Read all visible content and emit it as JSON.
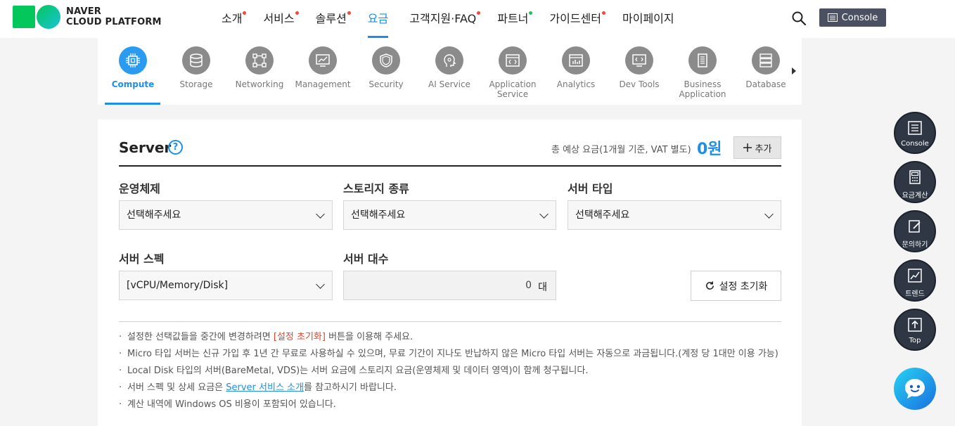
{
  "header": {
    "logo_line1": "NAVER",
    "logo_line2": "CLOUD PLATFORM",
    "nav": [
      {
        "label": "소개",
        "dot": "#f04a3a"
      },
      {
        "label": "서비스",
        "dot": "#f04a3a"
      },
      {
        "label": "솔루션",
        "dot": "#f04a3a"
      },
      {
        "label": "요금",
        "dot": "",
        "active": true
      },
      {
        "label": "고객지원·FAQ",
        "dot": "#f04a3a"
      },
      {
        "label": "파트너",
        "dot": "#2bbf5a"
      },
      {
        "label": "가이드센터",
        "dot": "#f04a3a"
      },
      {
        "label": "마이페이지",
        "dot": ""
      }
    ],
    "console_label": "Console"
  },
  "categories": [
    {
      "label": "Compute",
      "icon": "cpu-icon",
      "active": true
    },
    {
      "label": "Storage",
      "icon": "database-icon"
    },
    {
      "label": "Networking",
      "icon": "network-icon"
    },
    {
      "label": "Management",
      "icon": "monitor-chart-icon"
    },
    {
      "label": "Security",
      "icon": "shield-icon"
    },
    {
      "label": "AI Service",
      "icon": "ai-head-icon"
    },
    {
      "label": "Application Service",
      "icon": "app-window-icon"
    },
    {
      "label": "Analytics",
      "icon": "analytics-icon"
    },
    {
      "label": "Dev Tools",
      "icon": "code-monitor-icon"
    },
    {
      "label": "Business Application",
      "icon": "document-icon"
    },
    {
      "label": "Database",
      "icon": "server-stack-icon"
    }
  ],
  "main": {
    "title": "Server",
    "estimate_label": "총 예상 요금(1개월 기준, VAT 별도)",
    "estimate_value": "0원",
    "add_label": "추가",
    "fields": {
      "os_label": "운영체제",
      "os_value": "선택해주세요",
      "storage_label": "스토리지 종류",
      "storage_value": "선택해주세요",
      "type_label": "서버 타입",
      "type_value": "선택해주세요",
      "spec_label": "서버 스펙",
      "spec_value": "[vCPU/Memory/Disk]",
      "count_label": "서버 대수",
      "count_value": "0",
      "count_unit": "대"
    },
    "reset_label": "설정 초기화",
    "notes": {
      "n1_pre": "설정한 선택값들을 중간에 변경하려면 ",
      "n1_hl": "[설정 초기화]",
      "n1_post": " 버튼을 이용해 주세요.",
      "n2": "Micro 타입 서버는 신규 가입 후 1년 간 무료로 사용하실 수 있으며, 무료 기간이 지나도 반납하지 않은 Micro 타입 서버는 자동으로 과금됩니다.(계정 당 1대만 이용 가능)",
      "n3": "Local Disk 타입의 서버(BareMetal, VDS)는 서버 요금에 스토리지 요금(운영체제 및 데이터 영역)이 함께 청구됩니다.",
      "n4_pre": "서버 스펙 및 상세 요금은 ",
      "n4_link": "Server 서비스 소개",
      "n4_post": "를 참고하시기 바랍니다.",
      "n5": "계산 내역에 Windows OS 비용이 포함되어 있습니다."
    }
  },
  "floating": {
    "console": "Console",
    "pricing": "요금계산",
    "inquiry": "문의하기",
    "trend": "트렌드",
    "top": "Top"
  }
}
